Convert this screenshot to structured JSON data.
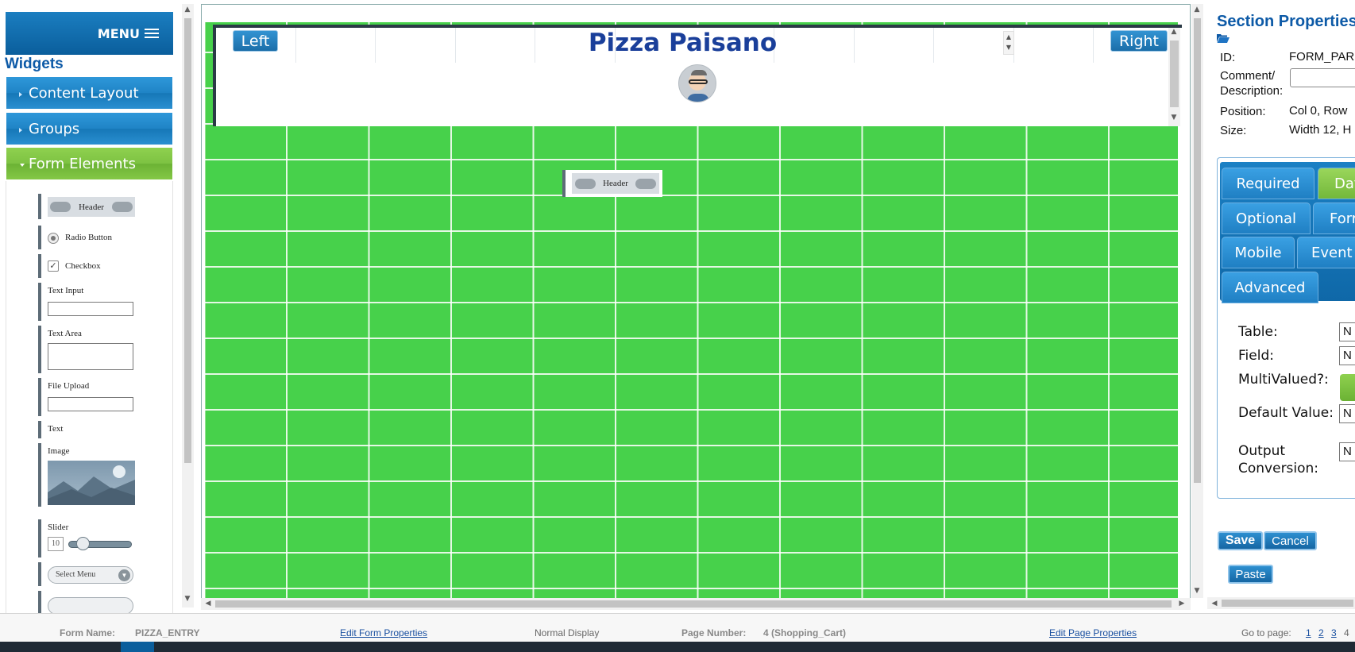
{
  "left_panel": {
    "menu_label": "MENU",
    "widgets_title": "Widgets",
    "categories": [
      {
        "label": "Content Layout"
      },
      {
        "label": "Groups"
      },
      {
        "label": "Form Elements"
      }
    ],
    "form_elements": {
      "header": "Header",
      "radio": "Radio Button",
      "checkbox": "Checkbox",
      "text_input": "Text Input",
      "text_area": "Text Area",
      "file_upload": "File Upload",
      "text": "Text",
      "image": "Image",
      "slider": "Slider",
      "slider_value": "10",
      "select_menu": "Select Menu"
    }
  },
  "canvas": {
    "title": "Pizza Paisano",
    "left_button": "Left",
    "right_button": "Right",
    "header_widget_label": "Header"
  },
  "right_panel": {
    "title": "Section Properties",
    "id_label": "ID:",
    "id_value": "FORM_PAR",
    "comment_label": "Comment/ Description:",
    "position_label": "Position:",
    "position_value": "Col 0, Row",
    "size_label": "Size:",
    "size_value": "Width 12, H",
    "tabs": [
      "Required",
      "Dat",
      "Optional",
      "Forr",
      "Mobile",
      "Event",
      "Advanced"
    ],
    "active_tab": "Dat",
    "fields": {
      "table_label": "Table:",
      "table_value": "N",
      "field_label": "Field:",
      "field_value": "N",
      "multivalued_label": "MultiValued?:",
      "default_label": "Default Value:",
      "default_value": "N",
      "output_label": "Output Conversion:",
      "output_value": "N"
    },
    "save_label": "Save",
    "cancel_label": "Cancel",
    "paste_label": "Paste"
  },
  "status_bar": {
    "form_name_label": "Form Name:",
    "form_name_value": "PIZZA_ENTRY",
    "edit_form_link": "Edit Form Properties",
    "display_mode": "Normal Display",
    "page_number_label": "Page Number:",
    "page_number_value": "4 (Shopping_Cart)",
    "edit_page_link": "Edit Page Properties",
    "goto_label": "Go to page:",
    "pages": [
      "1",
      "2",
      "3",
      "4"
    ]
  },
  "colors": {
    "grid_green": "#47d14b",
    "accent_blue": "#1f84c6",
    "accent_green": "#7dc242",
    "title_blue": "#1a3f9a"
  }
}
